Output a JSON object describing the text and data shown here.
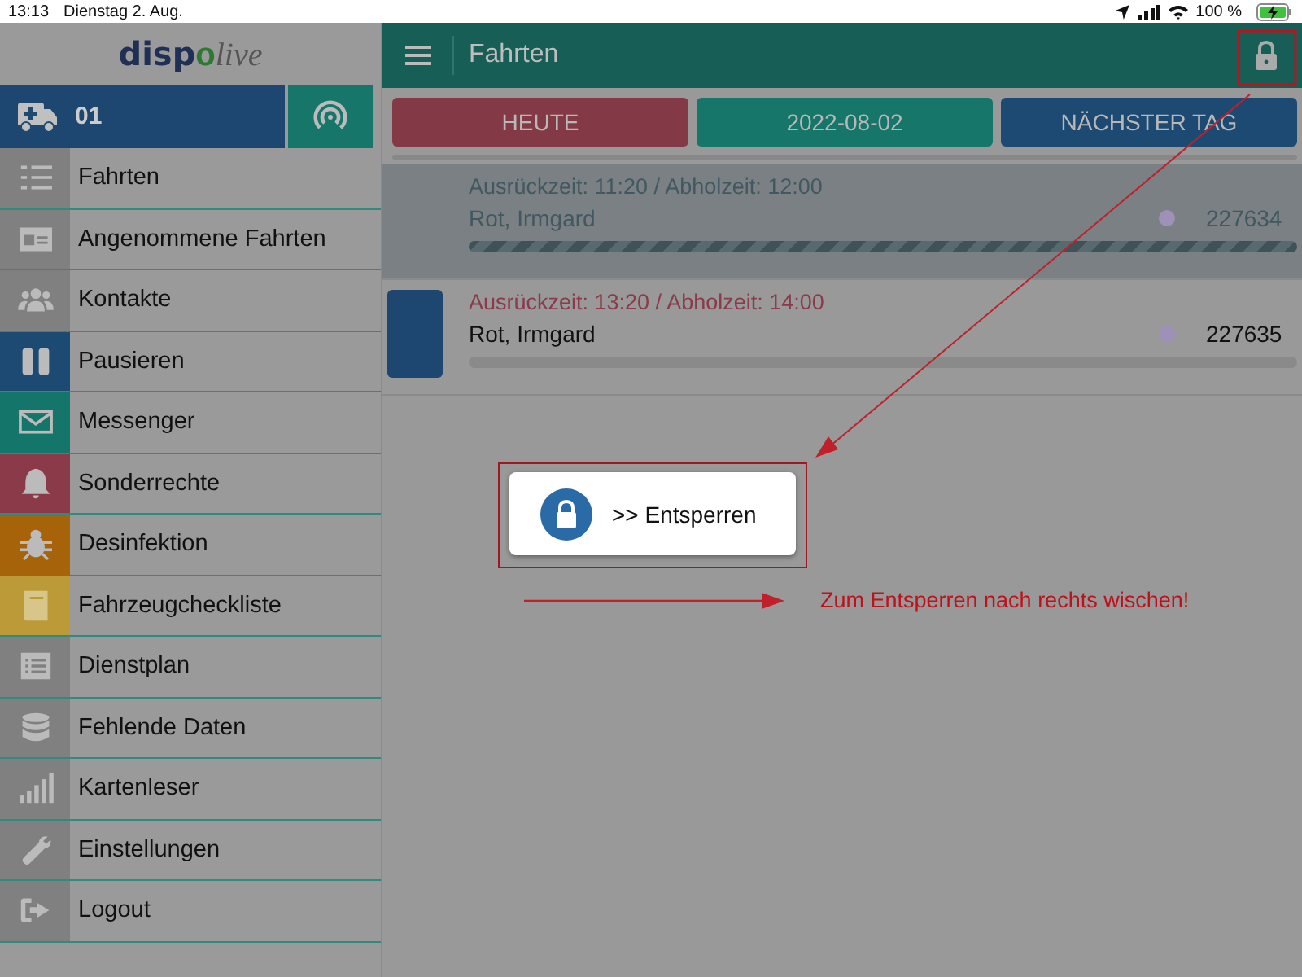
{
  "status_bar": {
    "time": "13:13",
    "date": "Dienstag 2. Aug.",
    "battery": "100 %"
  },
  "sidebar": {
    "logo": [
      "disp",
      "o",
      "live"
    ],
    "vehicle": "01",
    "items": [
      {
        "label": "Fahrten",
        "color": "#808080"
      },
      {
        "label": "Angenommene Fahrten",
        "color": "#808080"
      },
      {
        "label": "Kontakte",
        "color": "#808080"
      },
      {
        "label": "Pausieren",
        "color": "#1d4a72"
      },
      {
        "label": "Messenger",
        "color": "#14766a"
      },
      {
        "label": "Sonderrechte",
        "color": "#8a3a48"
      },
      {
        "label": "Desinfektion",
        "color": "#a6630a"
      },
      {
        "label": "Fahrzeugcheckliste",
        "color": "#bc9a38"
      },
      {
        "label": "Dienstplan",
        "color": "#808080"
      },
      {
        "label": "Fehlende Daten",
        "color": "#808080"
      },
      {
        "label": "Kartenleser",
        "color": "#808080"
      },
      {
        "label": "Einstellungen",
        "color": "#808080"
      },
      {
        "label": "Logout",
        "color": "#808080"
      }
    ]
  },
  "header": {
    "title": "Fahrten"
  },
  "day_buttons": [
    {
      "label": "HEUTE",
      "color": "#843a46"
    },
    {
      "label": "2022-08-02",
      "color": "#17766a"
    },
    {
      "label": "NÄCHSTER TAG",
      "color": "#1d4a72"
    }
  ],
  "trips": [
    {
      "times": "Ausrückzeit: 11:20 / Abholzeit: 12:00",
      "name": "Rot, Irmgard",
      "number": "227634",
      "disabled": true
    },
    {
      "times": "Ausrückzeit: 13:20 / Abholzeit: 14:00",
      "name": "Rot, Irmgard",
      "number": "227635",
      "disabled": false
    }
  ],
  "lock_overlay": {
    "unlock_button": ">> Entsperren",
    "hint": "Zum Entsperren nach rechts wischen!"
  }
}
